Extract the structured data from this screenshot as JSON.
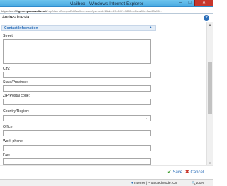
{
  "window": {
    "title": "Mailbox - Windows Internet Explorer",
    "minimize_glyph": "–",
    "maximize_glyph": "□",
    "close_glyph": "✕"
  },
  "address_bar": {
    "prefix": "https://ecn08.",
    "domain": "genesysconsults.net",
    "rest": "/ecp/UsersGroups/EditMailbox.aspx?pwmcid=1&ab=59bf10f1-3865-4d6e-a89d-0ab63a70f..."
  },
  "page": {
    "header_name": "Andres Iniesta",
    "help_glyph": "?"
  },
  "section": {
    "title": "Contact Information",
    "caret": "▲"
  },
  "fields": {
    "street_label": "Street:",
    "city_label": "City:",
    "state_label": "State/Province:",
    "zip_label": "ZIP/Postal code:",
    "country_label": "Country/Region:",
    "country_value": "",
    "office_label": "Office:",
    "work_phone_label": "Work phone:",
    "fax_label": "Fax:"
  },
  "footer": {
    "save_label": "Save",
    "save_icon": "✔",
    "cancel_label": "Cancel",
    "cancel_icon": "✖"
  },
  "status_bar": {
    "zone_text": "Internet | Protected Mode: On",
    "zoom_text": "100%"
  },
  "colors": {
    "accent": "#2a6eb9",
    "title_bar": "#49a9e1",
    "close_button": "#c7362c",
    "section_bg": "#e4edf7"
  }
}
